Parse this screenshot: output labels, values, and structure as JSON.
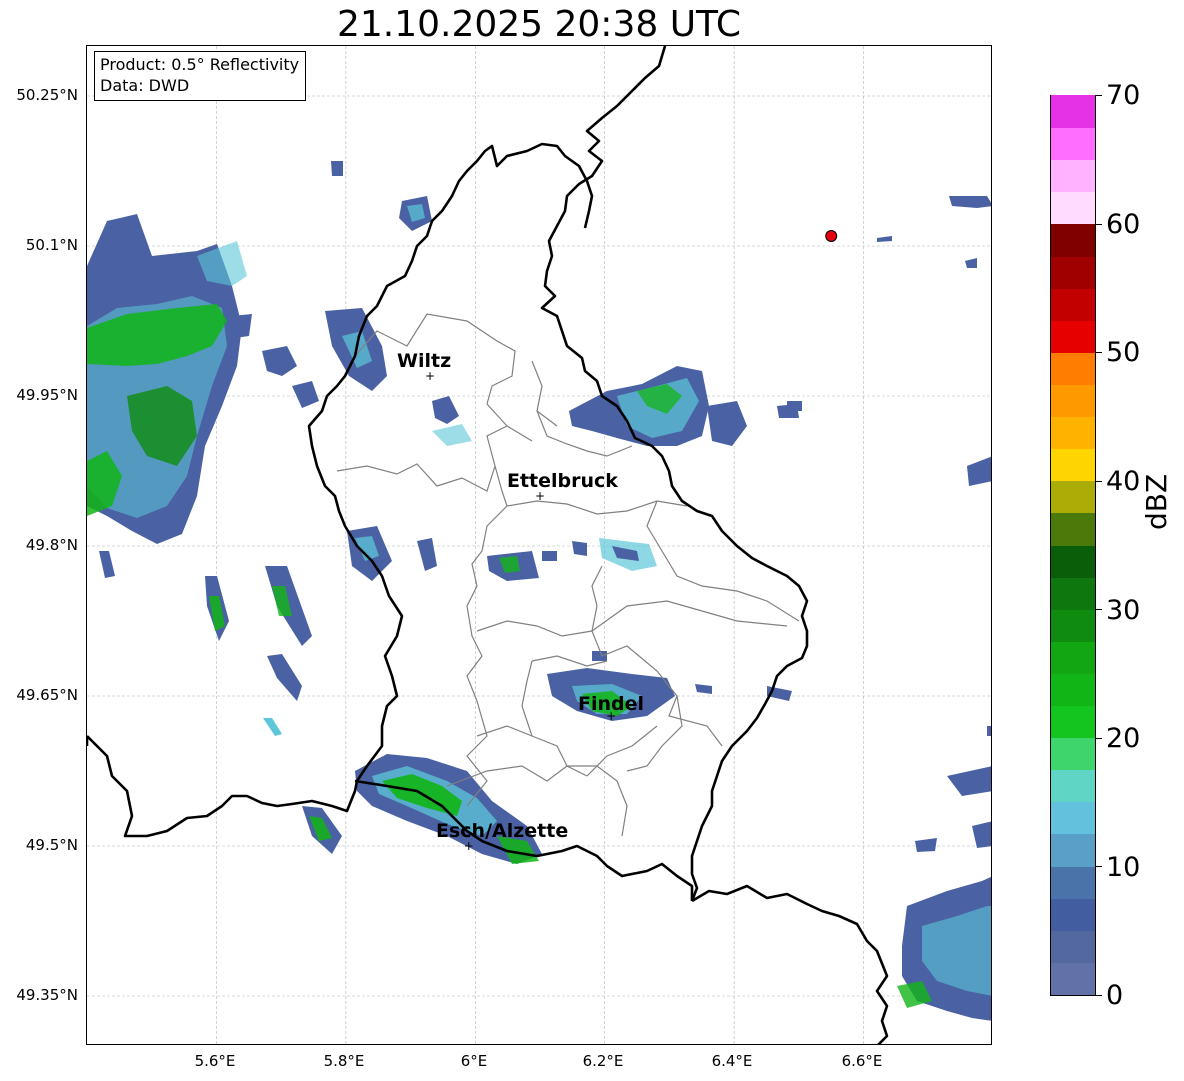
{
  "title": "21.10.2025 20:38 UTC",
  "info": {
    "product": "Product: 0.5° Reflectivity",
    "data": "Data: DWD"
  },
  "axes": {
    "lat_labels": [
      "50.25°N",
      "50.1°N",
      "49.95°N",
      "49.8°N",
      "49.65°N",
      "49.5°N",
      "49.35°N"
    ],
    "lon_labels": [
      "5.6°E",
      "5.8°E",
      "6°E",
      "6.2°E",
      "6.4°E",
      "6.6°E"
    ],
    "lon_range": [
      5.4,
      6.8
    ],
    "lat_range": [
      49.3,
      50.3
    ],
    "grid": true
  },
  "cities": [
    {
      "name": "Wiltz",
      "lon": 5.93,
      "lat": 49.97
    },
    {
      "name": "Ettelbruck",
      "lon": 6.1,
      "lat": 49.85
    },
    {
      "name": "Findel",
      "lon": 6.21,
      "lat": 49.63
    },
    {
      "name": "Esch/Alzette",
      "lon": 5.99,
      "lat": 49.5
    }
  ],
  "radar_site": {
    "lon": 6.55,
    "lat": 50.11,
    "color": "#e3000f"
  },
  "colorbar": {
    "label": "dBZ",
    "ticks": [
      "0",
      "10",
      "20",
      "30",
      "40",
      "50",
      "60",
      "70"
    ],
    "min": 0,
    "max": 70,
    "step": 2.5,
    "colors": [
      "#6272a9",
      "#53689f",
      "#435ea0",
      "#4a73aa",
      "#5aa0c6",
      "#62c1dc",
      "#5fd6c5",
      "#3ed56c",
      "#14c51f",
      "#12b516",
      "#13a613",
      "#0f8c0f",
      "#0e770e",
      "#0a5e0a",
      "#4b7a0b",
      "#abad06",
      "#ffd500",
      "#ffb300",
      "#ff9900",
      "#ff7d00",
      "#e60000",
      "#c30000",
      "#a00000",
      "#800000",
      "#ffdcff",
      "#ffb2ff",
      "#ff6eff",
      "#e632e6"
    ]
  },
  "overlay_colors": {
    "border": "#000000",
    "cantons": "#808080",
    "grid": "#b4b4b4",
    "echo_low": "#4a62a3",
    "echo_mid": "#5cc7d8",
    "echo_high": "#12b516"
  }
}
